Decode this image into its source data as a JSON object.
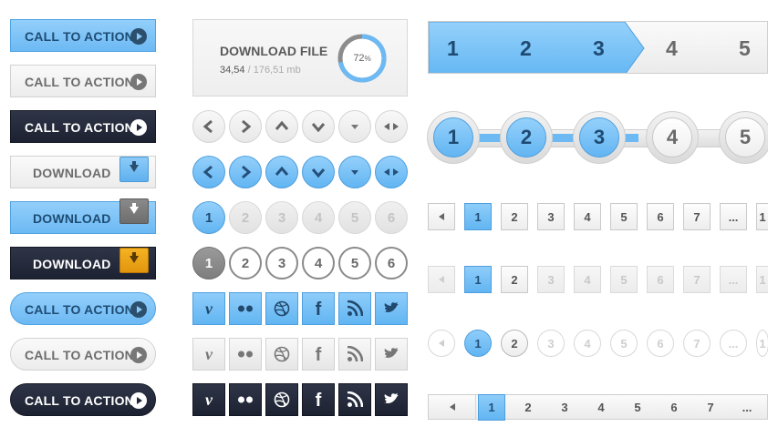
{
  "buttons": {
    "cta1": "CALL TO ACTION",
    "cta2": "CALL TO ACTION",
    "cta3": "CALL TO ACTION",
    "dl1": "DOWNLOAD",
    "dl2": "DOWNLOAD",
    "dl3": "DOWNLOAD",
    "cta4": "CALL TO ACTION",
    "cta5": "CALL TO ACTION",
    "cta6": "CALL TO ACTION"
  },
  "download_panel": {
    "title": "DOWNLOAD FILE",
    "size_done": "34,54",
    "size_total": "/ 176,51 mb",
    "percent_label": "72",
    "percent_unit": "%",
    "progress": 0.72
  },
  "number_circles": [
    "1",
    "2",
    "3",
    "4",
    "5",
    "6"
  ],
  "steps_arrow": {
    "items": [
      "1",
      "2",
      "3",
      "4",
      "5"
    ],
    "active_count": 3
  },
  "steps_circles": {
    "items": [
      "1",
      "2",
      "3",
      "4",
      "5"
    ],
    "active_count": 3
  },
  "pagination_square": {
    "items": [
      "1",
      "2",
      "3",
      "4",
      "5",
      "6",
      "7",
      "...",
      "1"
    ],
    "active": "1"
  },
  "pagination_square_faded": {
    "items": [
      "1",
      "2",
      "3",
      "4",
      "5",
      "6",
      "7",
      "...",
      "1"
    ],
    "active": "1"
  },
  "pagination_circle": {
    "items": [
      "1",
      "2",
      "3",
      "4",
      "5",
      "6",
      "7",
      "...",
      "1"
    ],
    "active": "1"
  },
  "pagination_bar": {
    "items": [
      "1",
      "2",
      "3",
      "4",
      "5",
      "6",
      "7",
      "..."
    ],
    "active": "1"
  },
  "icons": {
    "play": "play-icon",
    "download": "download-arrow-icon",
    "social": [
      "vimeo-icon",
      "flickr-icon",
      "dribbble-icon",
      "facebook-icon",
      "rss-icon",
      "twitter-icon"
    ]
  },
  "colors": {
    "accent_blue": "#6cb9f3",
    "dark": "#1d2232",
    "orange": "#f0a618",
    "text_blue": "#1e4c74"
  }
}
